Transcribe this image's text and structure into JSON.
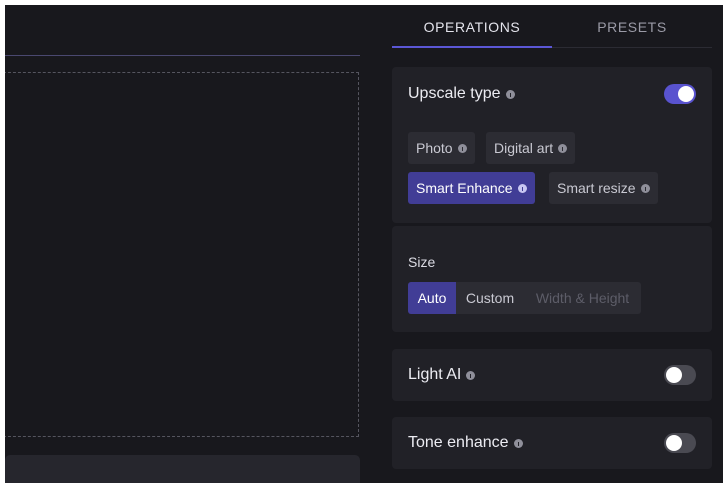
{
  "tabs": {
    "operations": "OPERATIONS",
    "presets": "PRESETS"
  },
  "upscale": {
    "title": "Upscale type",
    "toggle_on": true,
    "options": [
      {
        "label": "Photo",
        "selected": false
      },
      {
        "label": "Digital art",
        "selected": false
      },
      {
        "label": "Smart Enhance",
        "selected": true
      },
      {
        "label": "Smart resize",
        "selected": false
      }
    ]
  },
  "size": {
    "label": "Size",
    "options": [
      {
        "label": "Auto",
        "selected": true
      },
      {
        "label": "Custom",
        "selected": false
      },
      {
        "label": "Width & Height",
        "disabled": true
      }
    ]
  },
  "light_ai": {
    "title": "Light AI",
    "toggle_on": false
  },
  "tone_enhance": {
    "title": "Tone enhance",
    "toggle_on": false
  },
  "colors": {
    "accent": "#5953cf",
    "selected_chip": "#413d96",
    "background": "#18181d",
    "panel": "#212127"
  },
  "icons": {
    "info": "info-icon"
  }
}
